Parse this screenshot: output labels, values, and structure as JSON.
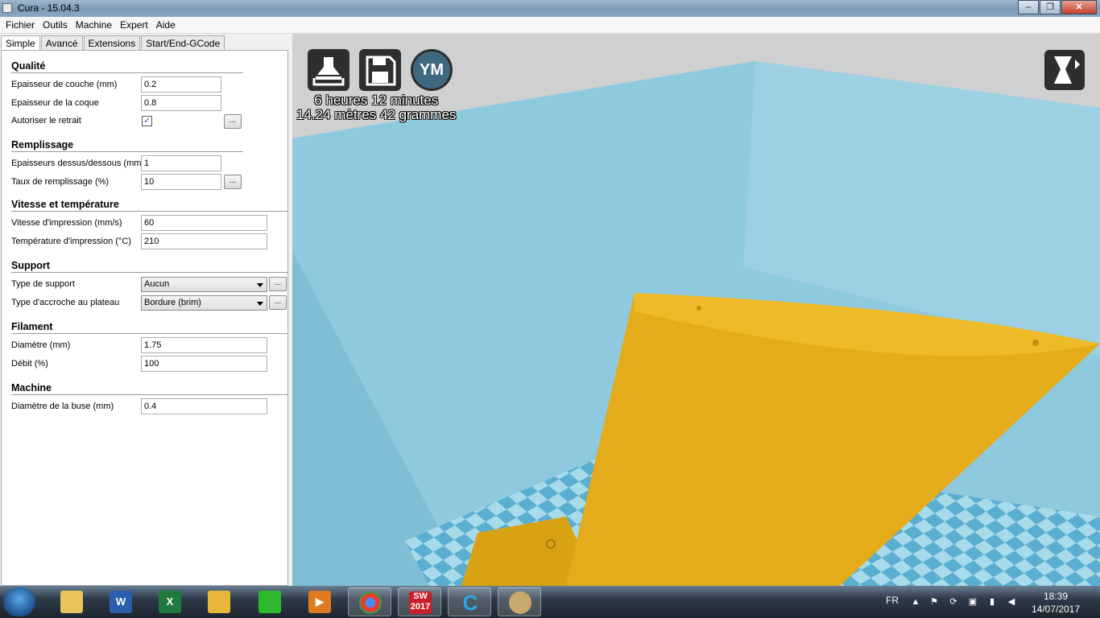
{
  "window": {
    "title": "Cura - 15.04.3",
    "minimize": "–",
    "maximize": "❐",
    "close": "✕"
  },
  "menu": [
    "Fichier",
    "Outils",
    "Machine",
    "Expert",
    "Aide"
  ],
  "tabs": [
    "Simple",
    "Avancé",
    "Extensions",
    "Start/End-GCode"
  ],
  "sections": {
    "qualite": {
      "title": "Qualité",
      "layer_label": "Epaisseur de couche (mm)",
      "layer_value": "0.2",
      "shell_label": "Epaisseur de la coque",
      "shell_value": "0.8",
      "retract_label": "Autoriser le retrait",
      "retract_checked": "✓"
    },
    "remplissage": {
      "title": "Remplissage",
      "topbottom_label": "Epaisseurs dessus/dessous (mm)",
      "topbottom_value": "1",
      "fill_label": "Taux de remplissage (%)",
      "fill_value": "10"
    },
    "vitesse": {
      "title": "Vitesse et température",
      "speed_label": "Vitesse d'impression (mm/s)",
      "speed_value": "60",
      "temp_label": "Température d'impression (°C)",
      "temp_value": "210"
    },
    "support": {
      "title": "Support",
      "type_label": "Type de support",
      "type_value": "Aucun",
      "adhesion_label": "Type d'accroche au plateau",
      "adhesion_value": "Bordure (brim)"
    },
    "filament": {
      "title": "Filament",
      "diameter_label": "Diamètre (mm)",
      "diameter_value": "1.75",
      "flow_label": "Débit (%)",
      "flow_value": "100"
    },
    "machine": {
      "title": "Machine",
      "nozzle_label": "Diamètre de la buse (mm)",
      "nozzle_value": "0.4"
    }
  },
  "more_button": "...",
  "viewport": {
    "ym_label": "YM",
    "print_time": "6 heures 12 minutes",
    "material": "14.24 mètres 42 grammes",
    "colors": {
      "model": "#e8b11c",
      "volume": "#8ec9de",
      "bed_light": "#a8dbe9",
      "bed_dark": "#5aaed0"
    }
  },
  "taskbar": {
    "apps": [
      {
        "name": "explorer",
        "label": ""
      },
      {
        "name": "word",
        "label": "W"
      },
      {
        "name": "excel",
        "label": "X"
      },
      {
        "name": "outlook",
        "label": ""
      },
      {
        "name": "tool",
        "label": ""
      },
      {
        "name": "media",
        "label": "▶"
      },
      {
        "name": "chrome",
        "label": ""
      },
      {
        "name": "solidworks",
        "label": "SW\n2017"
      },
      {
        "name": "cura",
        "label": "C"
      },
      {
        "name": "paint",
        "label": ""
      }
    ],
    "lang": "FR",
    "time": "18:39",
    "date": "14/07/2017"
  }
}
